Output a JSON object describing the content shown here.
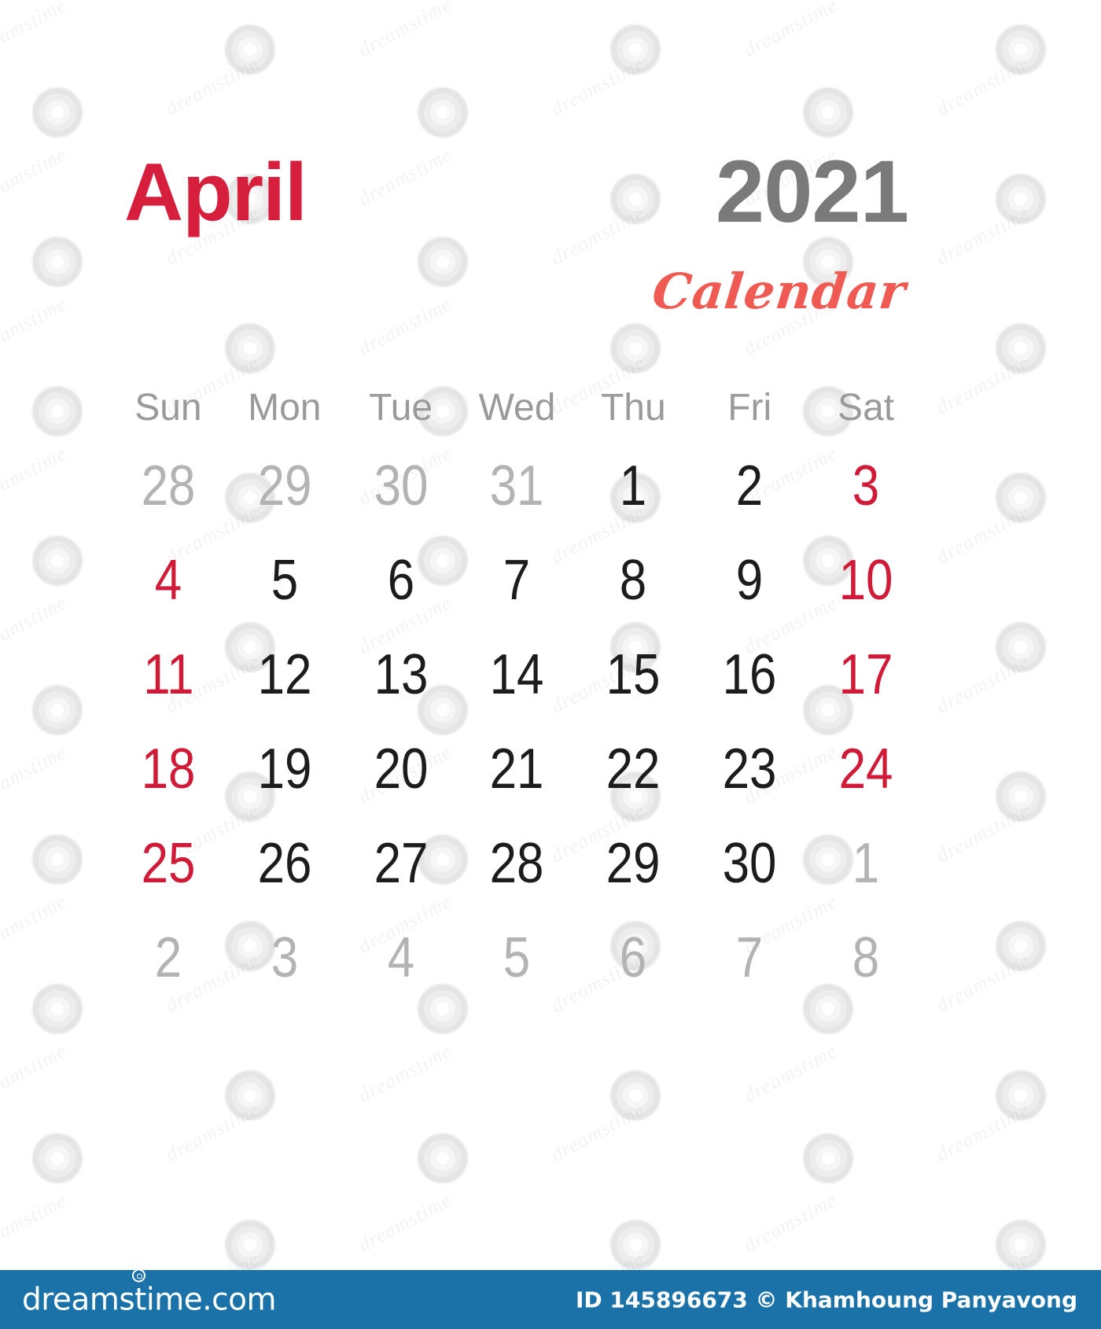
{
  "header": {
    "month": "April",
    "year": "2021",
    "subtitle": "Calendar"
  },
  "colors": {
    "month_red": "#d51f3c",
    "year_gray": "#7a7a7a",
    "script_red": "#ef5a52",
    "weekend_red": "#cf1b38",
    "current_black": "#1c1c1c",
    "adjacent_gray": "#b3b3b3",
    "header_gray": "#9a9a9a",
    "footer_blue": "#1b72a8"
  },
  "calendar": {
    "weekday_headers": [
      "Sun",
      "Mon",
      "Tue",
      "Wed",
      "Thu",
      "Fri",
      "Sat"
    ],
    "weeks": [
      [
        {
          "label": "28",
          "kind": "adjacent"
        },
        {
          "label": "29",
          "kind": "adjacent"
        },
        {
          "label": "30",
          "kind": "adjacent"
        },
        {
          "label": "31",
          "kind": "adjacent"
        },
        {
          "label": "1",
          "kind": "current"
        },
        {
          "label": "2",
          "kind": "current"
        },
        {
          "label": "3",
          "kind": "weekend"
        }
      ],
      [
        {
          "label": "4",
          "kind": "weekend"
        },
        {
          "label": "5",
          "kind": "current"
        },
        {
          "label": "6",
          "kind": "current"
        },
        {
          "label": "7",
          "kind": "current"
        },
        {
          "label": "8",
          "kind": "current"
        },
        {
          "label": "9",
          "kind": "current"
        },
        {
          "label": "10",
          "kind": "weekend"
        }
      ],
      [
        {
          "label": "11",
          "kind": "weekend"
        },
        {
          "label": "12",
          "kind": "current"
        },
        {
          "label": "13",
          "kind": "current"
        },
        {
          "label": "14",
          "kind": "current"
        },
        {
          "label": "15",
          "kind": "current"
        },
        {
          "label": "16",
          "kind": "current"
        },
        {
          "label": "17",
          "kind": "weekend"
        }
      ],
      [
        {
          "label": "18",
          "kind": "weekend"
        },
        {
          "label": "19",
          "kind": "current"
        },
        {
          "label": "20",
          "kind": "current"
        },
        {
          "label": "21",
          "kind": "current"
        },
        {
          "label": "22",
          "kind": "current"
        },
        {
          "label": "23",
          "kind": "current"
        },
        {
          "label": "24",
          "kind": "weekend"
        }
      ],
      [
        {
          "label": "25",
          "kind": "weekend"
        },
        {
          "label": "26",
          "kind": "current"
        },
        {
          "label": "27",
          "kind": "current"
        },
        {
          "label": "28",
          "kind": "current"
        },
        {
          "label": "29",
          "kind": "current"
        },
        {
          "label": "30",
          "kind": "current"
        },
        {
          "label": "1",
          "kind": "adjacent"
        }
      ],
      [
        {
          "label": "2",
          "kind": "adjacent"
        },
        {
          "label": "3",
          "kind": "adjacent"
        },
        {
          "label": "4",
          "kind": "adjacent"
        },
        {
          "label": "5",
          "kind": "adjacent"
        },
        {
          "label": "6",
          "kind": "adjacent"
        },
        {
          "label": "7",
          "kind": "adjacent"
        },
        {
          "label": "8",
          "kind": "adjacent"
        }
      ]
    ]
  },
  "footer": {
    "logo_text": "dreamstime.com",
    "credit": "ID 145896673 © Khamhoung Panyavong"
  },
  "watermark": {
    "text": "dreamstime"
  }
}
